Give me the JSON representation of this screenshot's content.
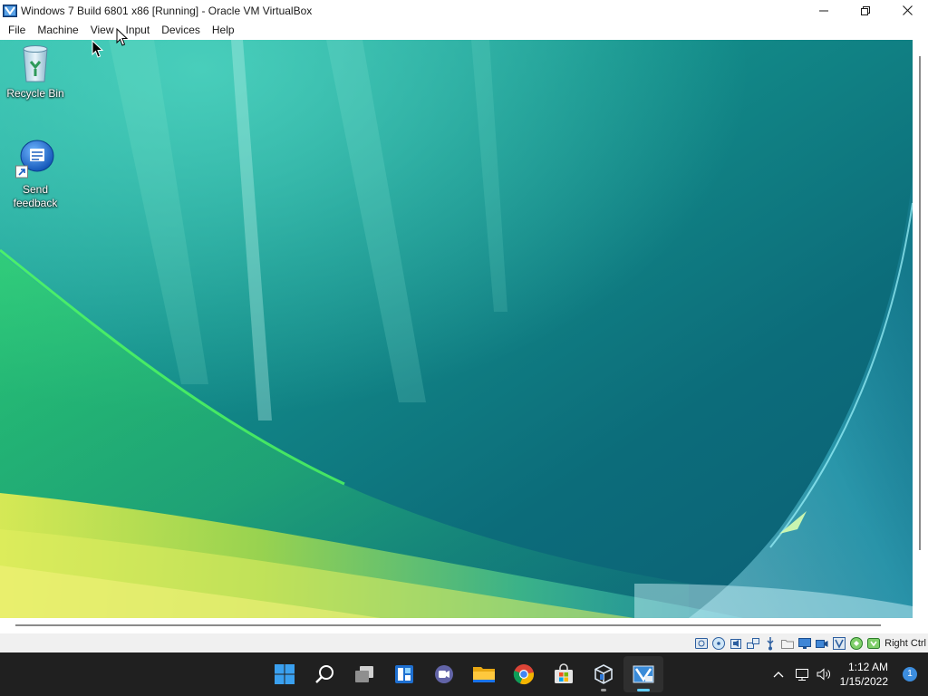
{
  "window": {
    "title": "Windows 7 Build 6801 x86 [Running] - Oracle VM VirtualBox",
    "app_icon": "virtualbox-vm-icon",
    "controls": [
      "minimize-icon",
      "maximize-icon",
      "close-icon"
    ]
  },
  "menubar": {
    "items": [
      "File",
      "Machine",
      "View",
      "Input",
      "Devices",
      "Help"
    ]
  },
  "desktop": {
    "icons": [
      {
        "label": "Recycle Bin",
        "icon": "recycle-bin-icon"
      },
      {
        "label": "Send feedback",
        "icon": "send-feedback-icon"
      }
    ]
  },
  "statusbar": {
    "indicators": [
      "hard-disk-icon",
      "optical-drive-icon",
      "audio-icon",
      "network-icon",
      "usb-icon",
      "shared-folders-icon",
      "display-icon",
      "video-capture-icon",
      "cpu-virtualization-icon",
      "mouse-integration-icon",
      "keyboard-icon"
    ],
    "host_key": "Right Ctrl"
  },
  "taskbar": {
    "apps": [
      {
        "name": "start-button",
        "icon": "windows-logo-icon",
        "running": false,
        "active": false
      },
      {
        "name": "search-button",
        "icon": "search-icon",
        "running": false,
        "active": false
      },
      {
        "name": "task-view-button",
        "icon": "task-view-icon",
        "running": false,
        "active": false
      },
      {
        "name": "widgets-button",
        "icon": "widgets-icon",
        "running": false,
        "active": false
      },
      {
        "name": "chat-button",
        "icon": "teams-chat-icon",
        "running": false,
        "active": false
      },
      {
        "name": "file-explorer-button",
        "icon": "folder-icon",
        "running": false,
        "active": false
      },
      {
        "name": "chrome-button",
        "icon": "chrome-icon",
        "running": false,
        "active": false
      },
      {
        "name": "store-button",
        "icon": "store-icon",
        "running": false,
        "active": false
      },
      {
        "name": "virtualbox-manager-button",
        "icon": "virtualbox-icon",
        "running": true,
        "active": false
      },
      {
        "name": "virtualbox-vm-button",
        "icon": "virtualbox-vm-icon",
        "running": true,
        "active": true
      }
    ],
    "tray": {
      "chevron_icon": "chevron-up-icon",
      "network_icon": "network-icon",
      "volume_icon": "speaker-icon",
      "time": "1:12 AM",
      "date": "1/15/2022",
      "notification_count": "1"
    }
  }
}
